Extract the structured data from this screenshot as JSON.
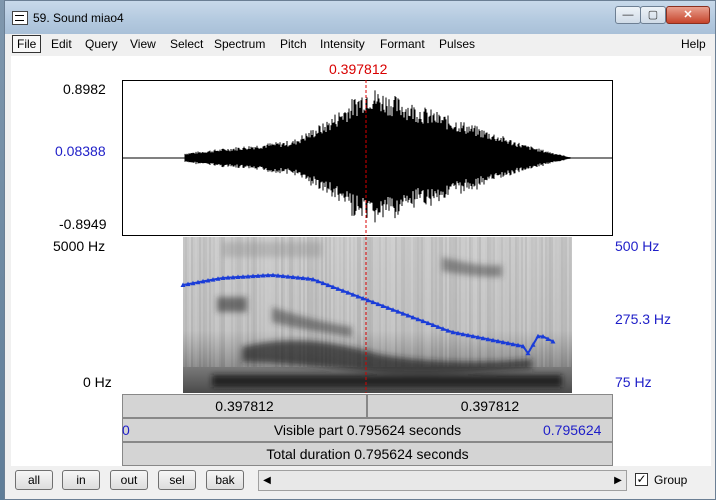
{
  "window": {
    "title": "59. Sound miao4"
  },
  "menu": [
    "File",
    "Edit",
    "Query",
    "View",
    "Select",
    "Spectrum",
    "Pitch",
    "Intensity",
    "Formant",
    "Pulses"
  ],
  "help_label": "Help",
  "cursor": {
    "time_label": "0.397812",
    "time": 0.397812,
    "color": "#d80000"
  },
  "waveform": {
    "max": "0.8982",
    "mid": "0.08388",
    "min": "-0.8949"
  },
  "spectrogram": {
    "top_label": "5000 Hz",
    "bottom_label": "0 Hz"
  },
  "pitch": {
    "top_label": "500 Hz",
    "mid_label": "275.3 Hz",
    "bottom_label": "75 Hz",
    "color": "#1a3cd8"
  },
  "selection_bar": {
    "left": "0.397812",
    "right": "0.397812"
  },
  "visible_bar": {
    "start": "0",
    "text": "Visible part 0.795624 seconds",
    "end": "0.795624"
  },
  "total_bar": {
    "text": "Total duration 0.795624 seconds"
  },
  "bottom": {
    "all": "all",
    "in": "in",
    "out": "out",
    "sel": "sel",
    "bak": "bak",
    "group_label": "Group",
    "group_checked": "✓"
  }
}
